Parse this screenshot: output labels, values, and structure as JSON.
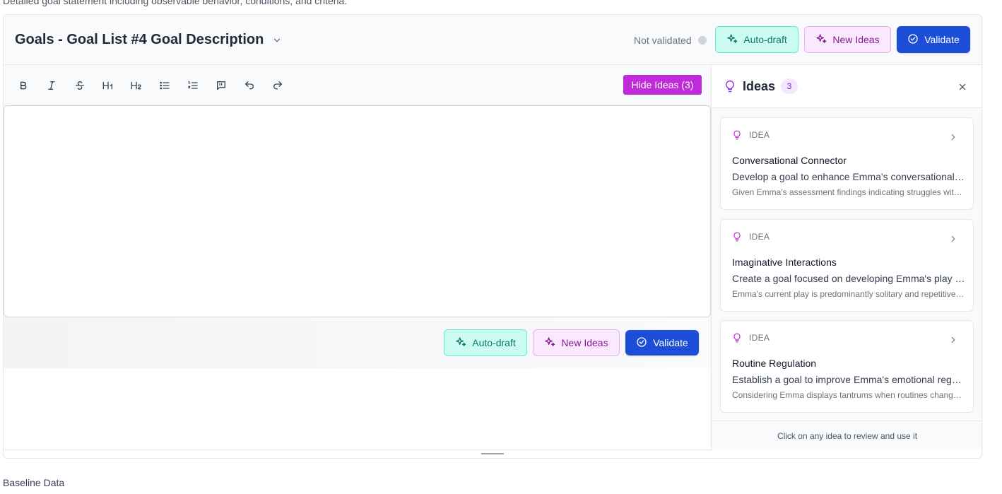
{
  "top_description": "Detailed goal statement including observable behavior, conditions, and criteria.",
  "header": {
    "title": "Goals - Goal List #4 Goal Description",
    "status": "Not validated",
    "auto_draft_label": "Auto-draft",
    "new_ideas_label": "New Ideas",
    "validate_label": "Validate"
  },
  "toolbar": {
    "tools": [
      "bold-icon",
      "italic-icon",
      "strikethrough-icon",
      "heading-1-icon",
      "heading-2-icon",
      "bullet-list-icon",
      "numbered-list-icon",
      "comment-icon",
      "undo-icon",
      "redo-icon"
    ],
    "h1_label": "H1",
    "h2_label": "H2",
    "hide_ideas_label": "Hide Ideas (3)"
  },
  "editor": {
    "content": ""
  },
  "footer": {
    "auto_draft_label": "Auto-draft",
    "new_ideas_label": "New Ideas",
    "validate_label": "Validate"
  },
  "ideas_panel": {
    "title": "Ideas",
    "count": "3",
    "footer_text": "Click on any idea to review and use it",
    "items": [
      {
        "tag": "IDEA",
        "title": "Conversational Connector",
        "description": "Develop a goal to enhance Emma's conversational skills by focusing on initiating and maintaining reciprocal exchanges.",
        "detail": "Given Emma's assessment findings indicating struggles with back-and-forth conversation..."
      },
      {
        "tag": "IDEA",
        "title": "Imaginative Interactions",
        "description": "Create a goal focused on developing Emma's play skills through imaginative and cooperative play activities.",
        "detail": "Emma's current play is predominantly solitary and repetitive, limiting peer engagement..."
      },
      {
        "tag": "IDEA",
        "title": "Routine Regulation",
        "description": "Establish a goal to improve Emma's emotional regulation during transitions and changes in routine.",
        "detail": "Considering Emma displays tantrums when routines change unexpectedly..."
      }
    ]
  },
  "next_section_label": "Baseline Data",
  "colors": {
    "accent_blue": "#1d4ed8",
    "accent_purple": "#c026d3",
    "teal": "#0f766e"
  }
}
